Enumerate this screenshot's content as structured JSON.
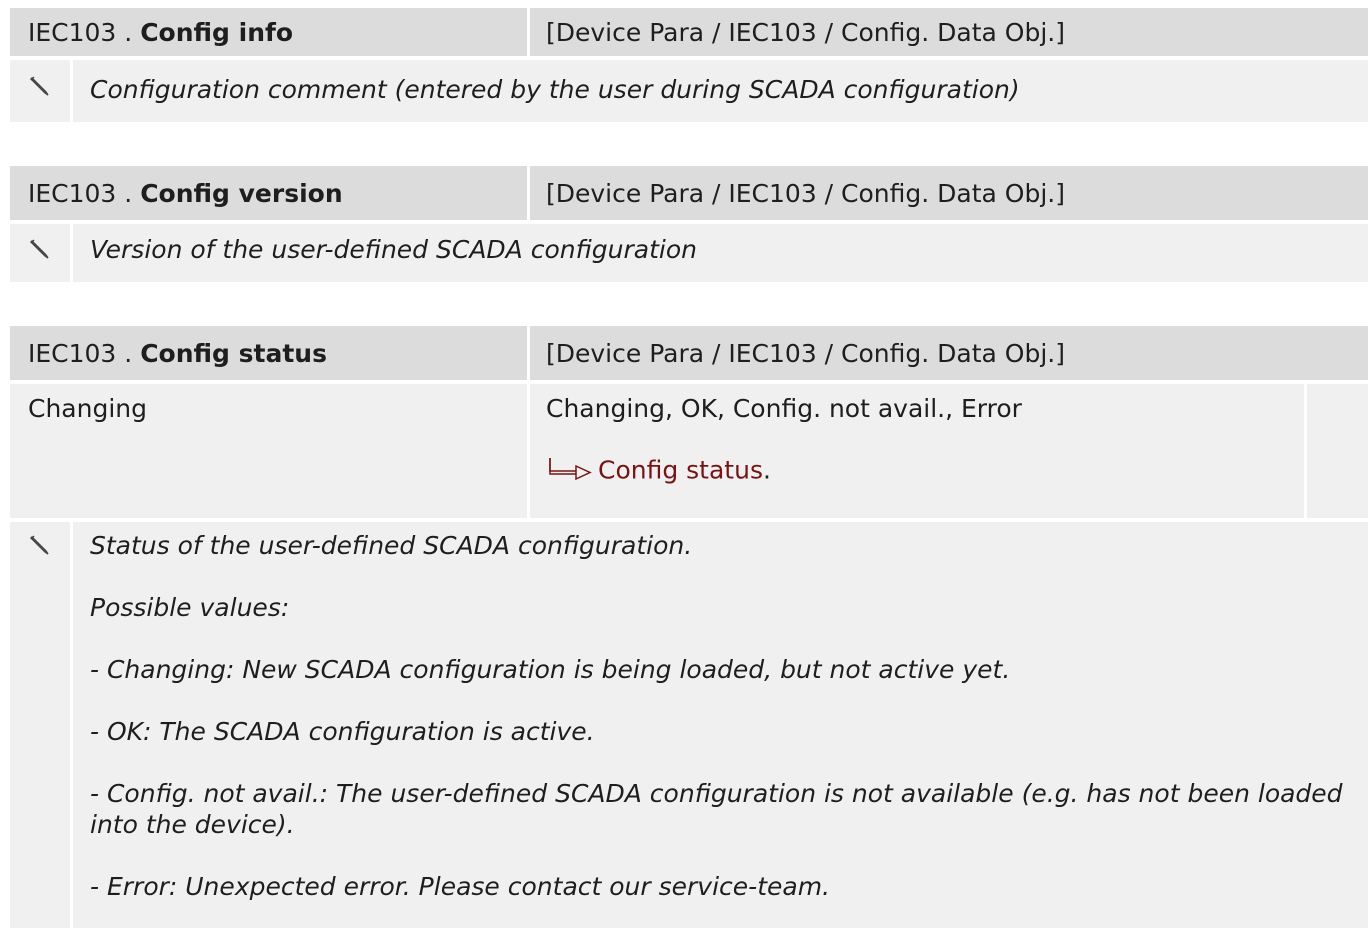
{
  "params": [
    {
      "module": "IEC103 . ",
      "name": "Config info",
      "path": "[Device Para / IEC103 / Config. Data Obj.]",
      "comment": "Configuration comment (entered by the user during SCADA configuration)"
    },
    {
      "module": "IEC103 . ",
      "name": "Config version",
      "path": "[Device Para / IEC103 / Config. Data Obj.]",
      "comment": "Version of the user-defined SCADA configuration"
    },
    {
      "module": "IEC103 . ",
      "name": "Config status",
      "path": "[Device Para / IEC103 / Config. Data Obj.]",
      "default": "Changing",
      "options": "Changing, OK, Config. not avail., Error",
      "link_text": "Config status",
      "link_suffix": ".",
      "description": [
        "Status of the user-defined SCADA configuration.",
        "Possible values:",
        "- Changing: New SCADA configuration is being loaded, but not active yet.",
        "- OK: The SCADA configuration is active.",
        "- Config. not avail.: The user-defined SCADA configuration is not available (e.g. has not been loaded into the device).",
        "- Error: Unexpected error. Please contact our service-team."
      ]
    }
  ],
  "icons": {
    "note": "pencil-icon",
    "link_arrow": "link-arrow-icon"
  },
  "colors": {
    "header_bg": "#dcdcdc",
    "cell_bg": "#f0f0f0",
    "link": "#7a1212"
  }
}
